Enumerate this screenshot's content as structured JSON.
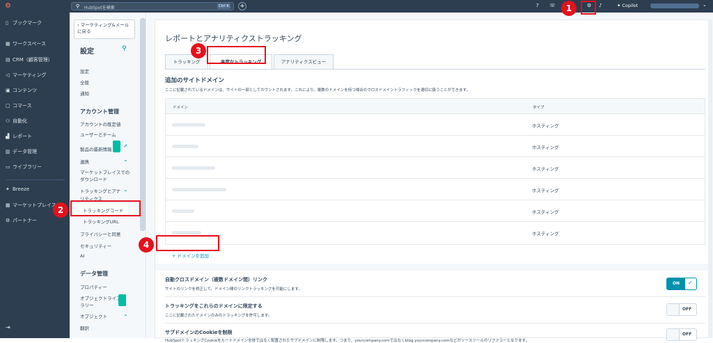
{
  "topbar": {
    "search_placeholder": "HubSpotを検索",
    "shortcut": "Ctrl K",
    "plus": "+",
    "copilot": "Copilot"
  },
  "rail": {
    "items": [
      "ブックマーク",
      "ワークスペース",
      "CRM（顧客管理）",
      "マーケティング",
      "コンテンツ",
      "コマース",
      "自動化",
      "レポート",
      "データ管理",
      "ライブラリー",
      "Breeze",
      "マーケットプレイス",
      "パートナー"
    ]
  },
  "sidebar": {
    "back": "マーケティング&メール",
    "back2": "に戻る",
    "title": "設定",
    "items": {
      "s1": "設定",
      "s2": "全般",
      "s3": "通知",
      "h1": "アカウント管理",
      "a1": "アカウントの既定値",
      "a2": "ユーザーとチーム",
      "a3": "製品の最新情報",
      "a4": "連携",
      "a5": "マーケットプレイスでの",
      "a5b": "ダウンロード",
      "a6": "トラッキングとアナ",
      "a6b": "リティクス",
      "a7": "トラッキングコード",
      "a8": "トラッキングURL",
      "a9": "プライバシーと同意",
      "a10": "セキュリティー",
      "a11": "AI",
      "h2": "データ管理",
      "d1": "プロパティー",
      "d2": "オブジェクトライブ",
      "d2b": "ラリー",
      "d3": "オブジェクト",
      "d4": "翻訳"
    }
  },
  "page": {
    "title": "レポートとアナリティクストラッキング",
    "tabs": [
      "トラッキング",
      "高度なトラッキング",
      "アナリティクスビュー"
    ],
    "section_title": "追加のサイトドメイン",
    "section_desc": "ここに記載されているドメインは、サイトの一部としてカウントされます。これにより、複数のドメインを持つ場合のクロスドメイントラフィックを適切に扱うことができます。",
    "col_domain": "ドメイン",
    "col_type": "タイプ",
    "rows": [
      "ホスティング",
      "ホスティング",
      "ホスティング",
      "ホスティング",
      "ホスティング",
      "ホスティング"
    ],
    "add_domain": "ドメインを追加",
    "settings": [
      {
        "title": "自動クロスドメイン（複数ドメイン間）リンク",
        "desc": "サイトのリンクを修正して、ドメイン間のリンクトラッキングを可能にします。",
        "state": "ON",
        "check": "✓"
      },
      {
        "title": "トラッキングをこれらのドメインに限定する",
        "desc": "ここに記載されたドメインのみのトラッキングを許可します。",
        "state": "OFF"
      },
      {
        "title": "サブドメインのCookieを制限",
        "desc": "HubSpotトラッキングCookieをルートドメイン全体ではなく配置されたサブドメインに制限します。つまり、yourcompany.comではなくblog.yourcompany.comなどがソースツールのリファラーとなります。",
        "state": "OFF"
      }
    ]
  },
  "markers": [
    "1",
    "2",
    "3",
    "4"
  ],
  "colors": {
    "accent": "#0091ae",
    "marker": "#e5101c",
    "nav": "#2d3e50"
  }
}
